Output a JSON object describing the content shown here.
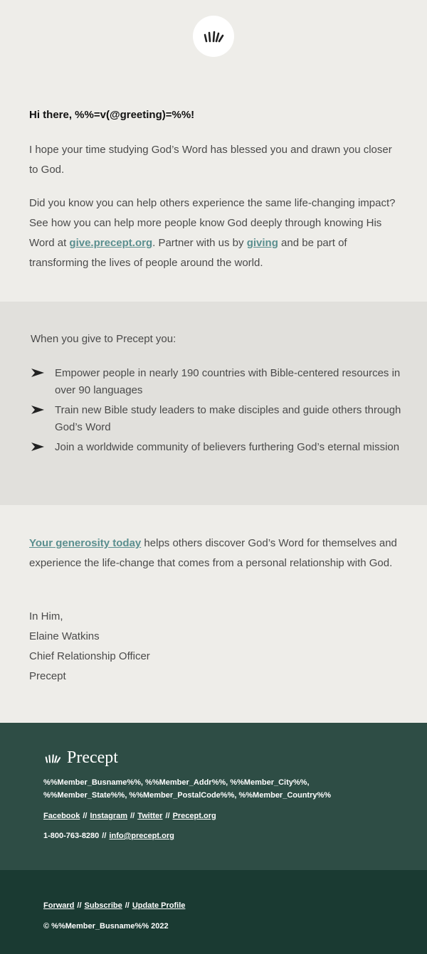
{
  "header": {
    "logo_icon": "precept-mark-icon"
  },
  "greeting": "Hi there, %%=v(@greeting)=%%!",
  "para1": "I hope your time studying God’s Word has blessed you and drawn you closer to God.",
  "para2": {
    "before": "Did you know you can help others experience the same life-changing impact? See how you can help more people know God deeply through knowing His Word at ",
    "link1": "give.precept.org",
    "middle": ". Partner with us by ",
    "link2": "giving",
    "after": " and be part of transforming the lives of people around the world."
  },
  "benefits": {
    "intro": "When you give to Precept you:",
    "items": [
      "Empower people in nearly 190 countries with Bible-centered resources in over 90 languages",
      "Train new Bible study leaders to make disciples and guide others through God’s Word",
      "Join a worldwide community of believers furthering God’s eternal mission"
    ]
  },
  "closing": {
    "link": "Your generosity today",
    "text": " helps others discover God’s Word for themselves and experience the life-change that comes from a personal relationship with God."
  },
  "signature": {
    "salutation": "In Him,",
    "name": "Elaine Watkins",
    "title": "Chief Relationship Officer",
    "org": "Precept"
  },
  "footer": {
    "brand": "Precept",
    "address_line1": "%%Member_Busname%%, %%Member_Addr%%, %%Member_City%%,",
    "address_line2": "%%Member_State%%, %%Member_PostalCode%%, %%Member_Country%%",
    "social": [
      "Facebook",
      "Instagram",
      "Twitter",
      "Precept.org"
    ],
    "separator": "//",
    "phone": "1-800-763-8280",
    "email": "info@precept.org"
  },
  "bottom": {
    "links": [
      "Forward",
      "Subscribe",
      "Update Profile"
    ],
    "copyright": "© %%Member_Busname%% 2022"
  },
  "colors": {
    "link": "#5b8f8f",
    "footer": "#2e4d45",
    "bottom": "#1a3a32",
    "band": "#e1e0dc",
    "bg": "#eeede9"
  }
}
